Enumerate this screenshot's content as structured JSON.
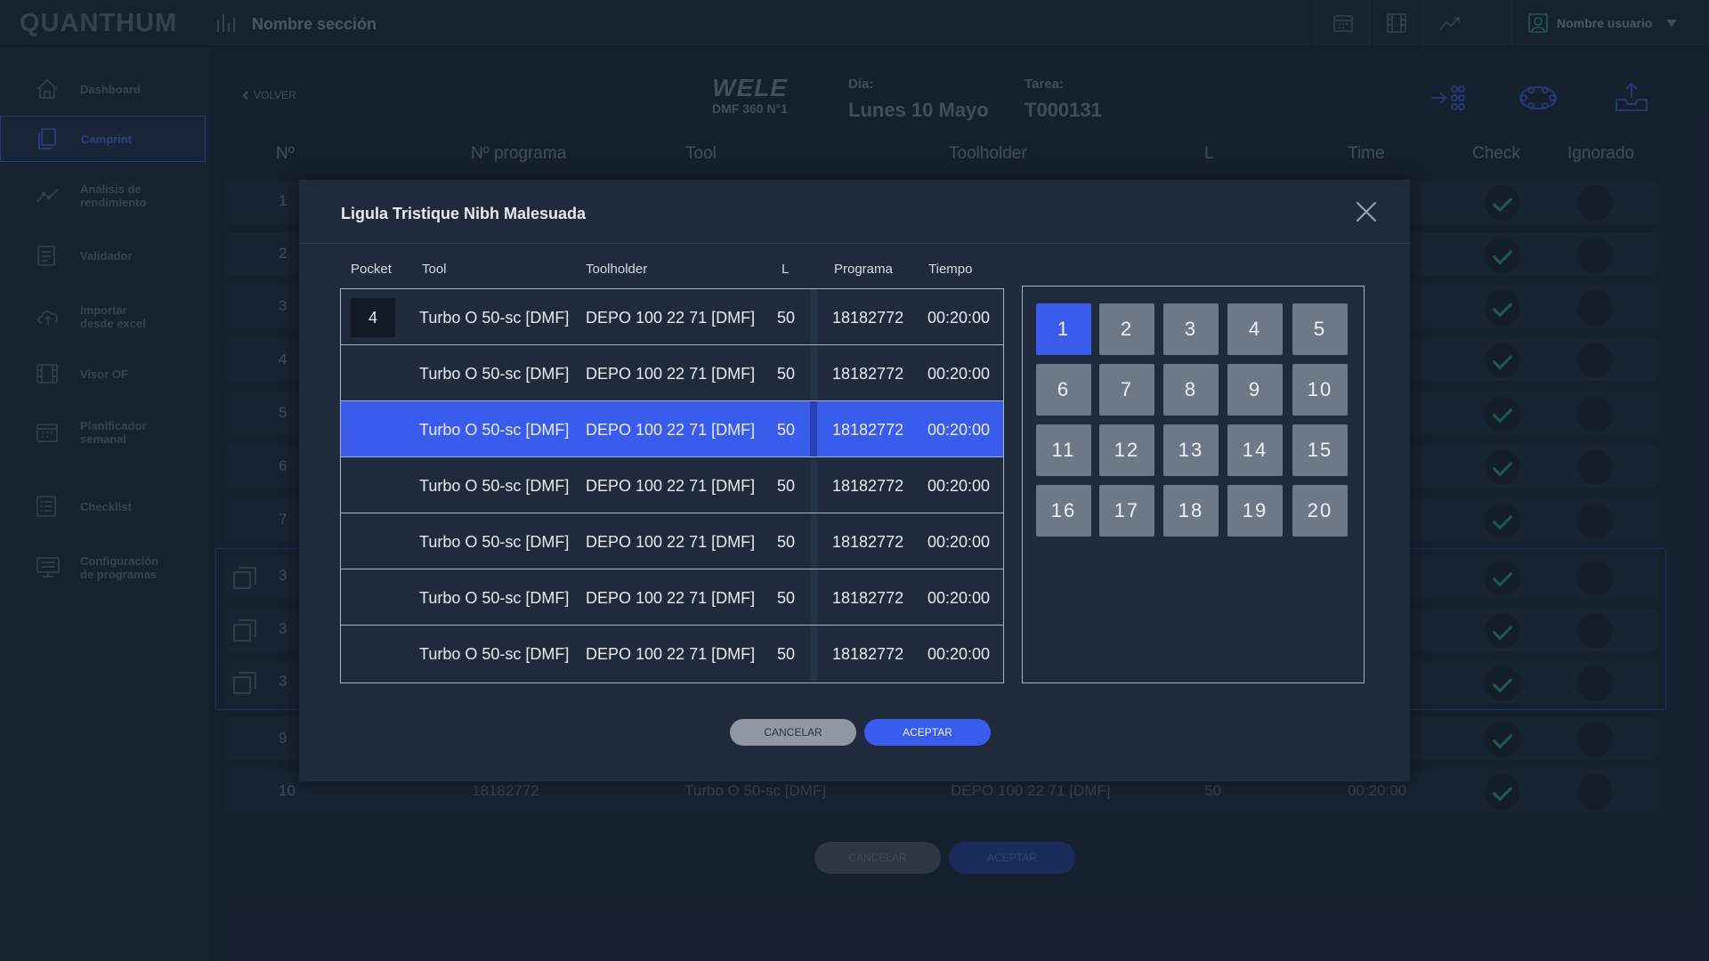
{
  "topbar": {
    "logo": "QUANTHUM",
    "section": "Nombre sección",
    "icons": [
      "calendar-icon",
      "film-icon",
      "trend-icon"
    ],
    "user": "Nombre usuario"
  },
  "sidebar": {
    "items": [
      {
        "label": "Dashboard",
        "icon": "home-icon",
        "active": false
      },
      {
        "label": "Camprint",
        "icon": "document-icon",
        "active": true
      },
      {
        "label": "Análisis de\nrendimiento",
        "icon": "chart-line-icon",
        "active": false
      },
      {
        "label": "Validador",
        "icon": "clipboard-icon",
        "active": false
      },
      {
        "label": "Importar\ndesde excel",
        "icon": "cloud-upload-icon",
        "active": false
      },
      {
        "label": "Visor OF",
        "icon": "film-icon",
        "active": false
      },
      {
        "label": "Planificador\nsemanal",
        "icon": "calendar-icon",
        "active": false
      },
      {
        "label": "Checklist",
        "icon": "checklist-icon",
        "active": false
      },
      {
        "label": "Configuración\nde programas",
        "icon": "monitor-settings-icon",
        "active": false
      }
    ]
  },
  "main": {
    "back_label": "VOLVER",
    "machine_logo": "WELE",
    "machine_name": "DMF 360 N°1",
    "day_label": "Día:",
    "day_value": "Lunes 10 Mayo",
    "task_label": "Tarea:",
    "task_value": "T000131",
    "columns": [
      "Nº",
      "Nº programa",
      "Tool",
      "Toolholder",
      "L",
      "Time",
      "Check",
      "Ignorado"
    ],
    "row_numbers": [
      "1",
      "2",
      "3",
      "4",
      "5",
      "6",
      "7",
      "3",
      "3",
      "3",
      "9",
      "10"
    ],
    "last_row": {
      "program": "18182772",
      "tool": "Turbo O 50-sc [DMF]",
      "toolholder": "DEPO 100 22 71 [DMF]",
      "l": "50",
      "time": "00:20:00"
    },
    "cancel_label": "CANCELAR",
    "accept_label": "ACEPTAR"
  },
  "modal": {
    "title": "Ligula Tristique Nibh Malesuada",
    "headers": {
      "pocket": "Pocket",
      "tool": "Tool",
      "toolholder": "Toolholder",
      "l": "L",
      "programa": "Programa",
      "tiempo": "Tiempo"
    },
    "rows": [
      {
        "pocket": "4",
        "tool": "Turbo O 50-sc [DMF]",
        "toolholder": "DEPO 100 22 71 [DMF]",
        "l": "50",
        "programa": "18182772",
        "tiempo": "00:20:00",
        "selected": false
      },
      {
        "pocket": "",
        "tool": "Turbo O 50-sc [DMF]",
        "toolholder": "DEPO 100 22 71 [DMF]",
        "l": "50",
        "programa": "18182772",
        "tiempo": "00:20:00",
        "selected": false
      },
      {
        "pocket": "",
        "tool": "Turbo O 50-sc [DMF]",
        "toolholder": "DEPO 100 22 71 [DMF]",
        "l": "50",
        "programa": "18182772",
        "tiempo": "00:20:00",
        "selected": true
      },
      {
        "pocket": "",
        "tool": "Turbo O 50-sc [DMF]",
        "toolholder": "DEPO 100 22 71 [DMF]",
        "l": "50",
        "programa": "18182772",
        "tiempo": "00:20:00",
        "selected": false
      },
      {
        "pocket": "",
        "tool": "Turbo O 50-sc [DMF]",
        "toolholder": "DEPO 100 22 71 [DMF]",
        "l": "50",
        "programa": "18182772",
        "tiempo": "00:20:00",
        "selected": false
      },
      {
        "pocket": "",
        "tool": "Turbo O 50-sc [DMF]",
        "toolholder": "DEPO 100 22 71 [DMF]",
        "l": "50",
        "programa": "18182772",
        "tiempo": "00:20:00",
        "selected": false
      },
      {
        "pocket": "",
        "tool": "Turbo O 50-sc [DMF]",
        "toolholder": "DEPO 100 22 71 [DMF]",
        "l": "50",
        "programa": "18182772",
        "tiempo": "00:20:00",
        "selected": false
      }
    ],
    "pockets": [
      "1",
      "2",
      "3",
      "4",
      "5",
      "6",
      "7",
      "8",
      "9",
      "10",
      "11",
      "12",
      "13",
      "14",
      "15",
      "16",
      "17",
      "18",
      "19",
      "20"
    ],
    "active_pocket": "1",
    "cancel_label": "CANCELAR",
    "accept_label": "ACEPTAR"
  },
  "colors": {
    "accent": "#3a5ced",
    "background": "#1a2637",
    "modal": "#1f2b3c",
    "check": "#2a7d6f"
  }
}
